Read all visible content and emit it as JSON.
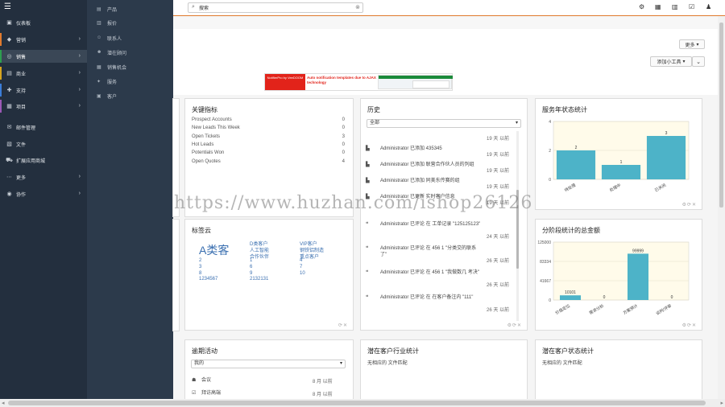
{
  "nav": {
    "items": [
      {
        "label": "仪表板",
        "icon": "dashboard-icon",
        "glyph": "▣",
        "chev": false
      },
      {
        "label": "营销",
        "icon": "megaphone-icon",
        "glyph": "◆",
        "chev": true,
        "bar": "#e07a2e"
      },
      {
        "label": "销售",
        "icon": "target-icon",
        "glyph": "◎",
        "chev": true,
        "bar": "#2e9e4f",
        "active": true
      },
      {
        "label": "商业",
        "icon": "cart-icon",
        "glyph": "▤",
        "chev": true,
        "bar": "#d6a41f"
      },
      {
        "label": "支持",
        "icon": "lifebuoy-icon",
        "glyph": "✚",
        "chev": true,
        "bar": "#3b7dd8"
      },
      {
        "label": "项目",
        "icon": "project-icon",
        "glyph": "▦",
        "chev": true,
        "bar": "#9b59b6"
      },
      {
        "label": "邮件管理",
        "icon": "mail-icon",
        "glyph": "✉",
        "chev": false
      },
      {
        "label": "文件",
        "icon": "file-icon",
        "glyph": "▧",
        "chev": false
      },
      {
        "label": "扩展应用商城",
        "icon": "store-icon",
        "glyph": "⛟",
        "chev": false
      },
      {
        "label": "更多",
        "icon": "more-icon",
        "glyph": "⋯",
        "chev": true
      },
      {
        "label": "协作",
        "icon": "globe-icon",
        "glyph": "◉",
        "chev": true
      }
    ]
  },
  "submenu": {
    "items": [
      {
        "label": "产品",
        "icon": "product-icon",
        "glyph": "▤"
      },
      {
        "label": "报价",
        "icon": "quote-icon",
        "glyph": "▥"
      },
      {
        "label": "联系人",
        "icon": "contact-icon",
        "glyph": "☺"
      },
      {
        "label": "潜在顾问",
        "icon": "lead-icon",
        "glyph": "☻"
      },
      {
        "label": "销售机会",
        "icon": "opportunity-icon",
        "glyph": "▦"
      },
      {
        "label": "服务",
        "icon": "service-icon",
        "glyph": "✦"
      },
      {
        "label": "客户",
        "icon": "account-icon",
        "glyph": "▣"
      }
    ]
  },
  "topbar": {
    "search_value": "搜索",
    "icons": [
      "gear-icon",
      "calendar-icon",
      "chart-icon",
      "checkbox-icon",
      "user-icon"
    ]
  },
  "toolbar": {
    "more_label": "更多",
    "tools_label": "添加小工具"
  },
  "banner": {
    "left_text": "NotifierPro by VeeDOOM",
    "mid_text": "Auto notification templates due to AJAX technology"
  },
  "kpi_panel": {
    "title": "关键指标",
    "rows": [
      {
        "label": "Prospect Accounts",
        "value": "0"
      },
      {
        "label": "New Leads This Week",
        "value": "0"
      },
      {
        "label": "Open Tickets",
        "value": "3"
      },
      {
        "label": "Hot Leads",
        "value": "0"
      },
      {
        "label": "Potentials Won",
        "value": "0"
      },
      {
        "label": "Open Quotes",
        "value": "4"
      }
    ]
  },
  "history_panel": {
    "title": "历史",
    "filter": "全部",
    "items": [
      {
        "icon": "building-icon",
        "glyph": "▙",
        "text": "",
        "time": "19 天 以前"
      },
      {
        "icon": "building-icon",
        "glyph": "▙",
        "text": "Administrator 已添加 435345",
        "time": "19 天 以前"
      },
      {
        "icon": "building-icon",
        "glyph": "▙",
        "text": "Administrator 已添加 联营合作伙人员的列组",
        "time": "19 天 以前"
      },
      {
        "icon": "building-icon",
        "glyph": "▙",
        "text": "Administrator 已添加 同美东传赛的组",
        "time": "19 天 以前"
      },
      {
        "icon": "building-icon",
        "glyph": "▙",
        "text": "Administrator 已更新 实时客户信息",
        "time": "19 天 以前"
      },
      {
        "icon": "comment-icon",
        "glyph": "❝",
        "text": "Administrator 已评论 在 工单记录 \"125125123\"",
        "time": "24 天 以前"
      },
      {
        "icon": "comment-icon",
        "glyph": "❝",
        "text": "Administrator 已评论 在 456 1 \"分类交的联系了\"",
        "time": "26 天 以前"
      },
      {
        "icon": "comment-icon",
        "glyph": "❝",
        "text": "Administrator 已评论 在 456 1 \"我做数几 考决\"",
        "time": "26 天 以前"
      },
      {
        "icon": "comment-icon",
        "glyph": "❝",
        "text": "Administrator 已评论 在 在客户备注内 \"111\"",
        "time": "26 天 以前"
      }
    ]
  },
  "service_chart_panel": {
    "title": "服务年状态统计"
  },
  "funnel_chart_panel": {
    "title": "分阶段统计的总金额"
  },
  "tags_panel": {
    "title": "标签云",
    "tags": [
      {
        "text": "A类客",
        "size": "big"
      },
      {
        "text": "D类客户"
      },
      {
        "text": "VIP客户"
      },
      {
        "text": "人工智能"
      },
      {
        "text": "钢铁铝制造"
      },
      {
        "text": "合作伙伴"
      },
      {
        "text": "重点客户"
      },
      {
        "text": "2"
      },
      {
        "text": "1"
      },
      {
        "text": "4"
      },
      {
        "text": "3"
      },
      {
        "text": "6"
      },
      {
        "text": "7"
      },
      {
        "text": "8"
      },
      {
        "text": "9"
      },
      {
        "text": "10"
      },
      {
        "text": "1234567"
      },
      {
        "text": "2132131"
      }
    ]
  },
  "overdue_panel": {
    "title": "逾期活动",
    "filter": "我的",
    "items": [
      {
        "icon": "users-icon",
        "glyph": "☗",
        "text": "会议",
        "time": "8 月 以前"
      },
      {
        "icon": "check-icon",
        "glyph": "☑",
        "text": "拜访高端",
        "time": "8 月 以前"
      }
    ]
  },
  "industry_panel": {
    "title": "潜在客户行业统计",
    "empty_text": "无相应的 文件匹配"
  },
  "status_panel": {
    "title": "潜在客户状态统计",
    "empty_text": "无相应的 文件匹配"
  },
  "watermark": "https://www.huzhan.com/ishop26126",
  "chart_data": [
    {
      "type": "bar",
      "title": "服务年状态统计",
      "categories": [
        "待处理",
        "处理中",
        "已关闭"
      ],
      "values": [
        2,
        1,
        3
      ],
      "ylim": [
        0,
        4
      ],
      "yticks": [
        0,
        2,
        4
      ],
      "color": "#4db3c8",
      "grid": true,
      "xlabel": "",
      "ylabel": ""
    },
    {
      "type": "bar",
      "title": "分阶段统计的总金额",
      "categories": [
        "价值定位",
        "需求分析",
        "方案预计",
        "谈判/评审"
      ],
      "values": [
        10101,
        0,
        99999,
        0
      ],
      "ylim": [
        0,
        125000
      ],
      "yticks": [
        0,
        41667,
        83334,
        125000
      ],
      "color": "#4db3c8",
      "grid": true,
      "xlabel": "",
      "ylabel": ""
    }
  ]
}
